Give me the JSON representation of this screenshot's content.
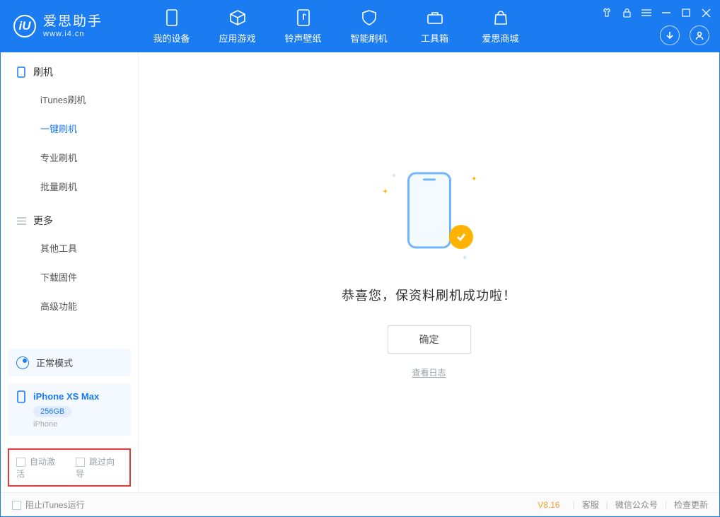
{
  "app": {
    "title": "爱思助手",
    "subtitle": "www.i4.cn",
    "logo_letter": "iU"
  },
  "nav": {
    "items": [
      {
        "label": "我的设备"
      },
      {
        "label": "应用游戏"
      },
      {
        "label": "铃声壁纸"
      },
      {
        "label": "智能刷机"
      },
      {
        "label": "工具箱"
      },
      {
        "label": "爱思商城"
      }
    ],
    "active_index": 3
  },
  "sidebar": {
    "groups": [
      {
        "title": "刷机",
        "items": [
          {
            "label": "iTunes刷机"
          },
          {
            "label": "一键刷机",
            "active": true
          },
          {
            "label": "专业刷机"
          },
          {
            "label": "批量刷机"
          }
        ]
      },
      {
        "title": "更多",
        "items": [
          {
            "label": "其他工具"
          },
          {
            "label": "下载固件"
          },
          {
            "label": "高级功能"
          }
        ]
      }
    ],
    "mode_label": "正常模式",
    "device": {
      "name": "iPhone XS Max",
      "storage": "256GB",
      "type": "iPhone"
    },
    "options": {
      "auto_activate": "自动激活",
      "skip_guide": "跳过向导"
    }
  },
  "main": {
    "success_text": "恭喜您，保资料刷机成功啦！",
    "ok_label": "确定",
    "log_link": "查看日志"
  },
  "statusbar": {
    "block_itunes": "阻止iTunes运行",
    "version": "V8.16",
    "links": {
      "support": "客服",
      "wechat": "微信公众号",
      "update": "检查更新"
    }
  }
}
